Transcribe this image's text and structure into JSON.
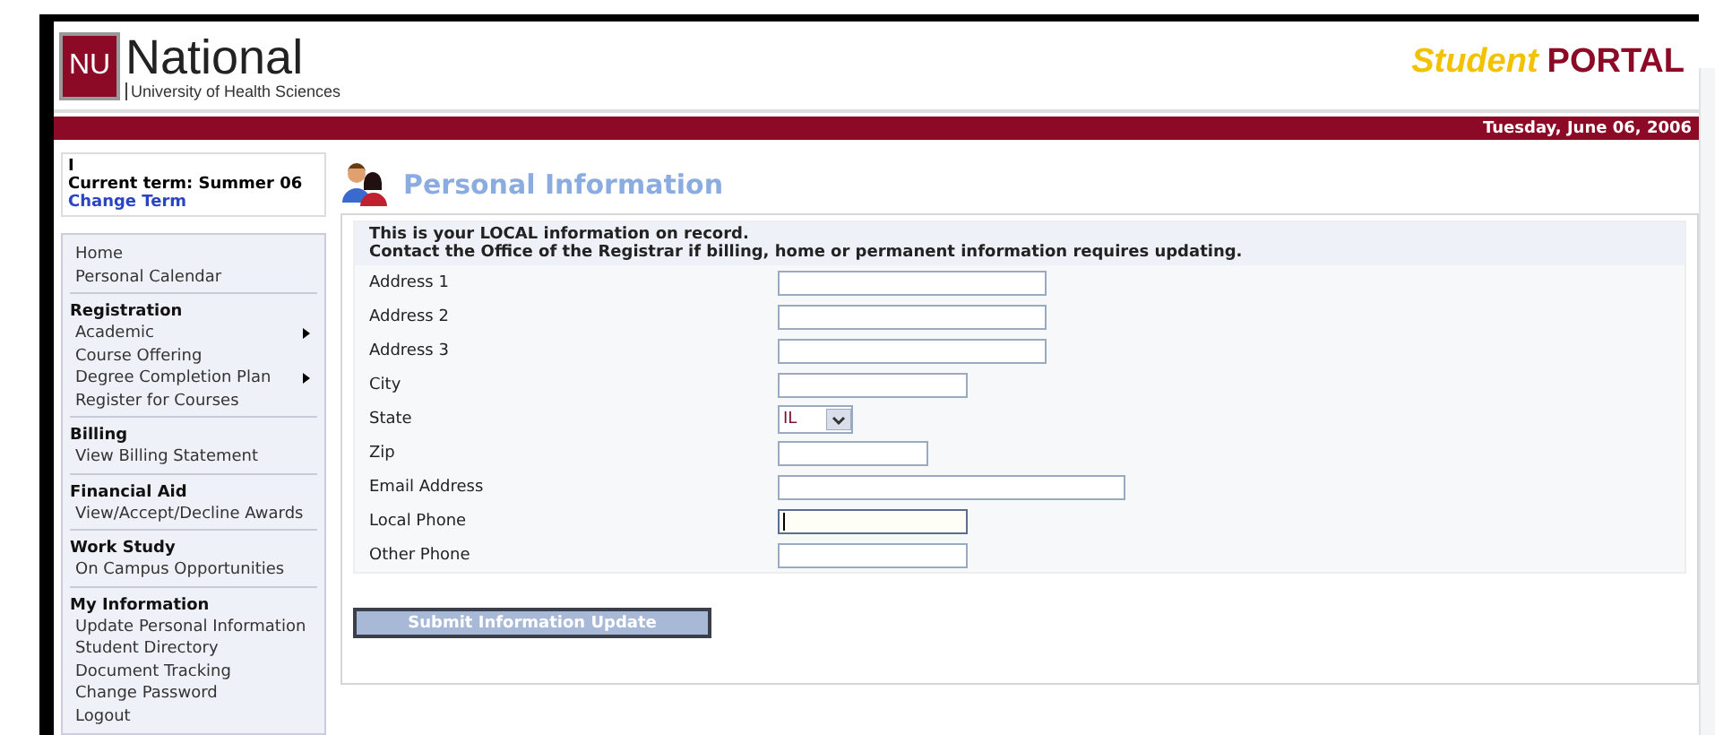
{
  "header": {
    "logo_mark": "NU",
    "logo_name": "National",
    "logo_subtitle": "University of Health Sciences",
    "portal_word1": "Student",
    "portal_word2": "PORTAL"
  },
  "date_bar": {
    "date": "Tuesday, June 06, 2006"
  },
  "term_box": {
    "user": "I",
    "current_term": "Current term: Summer 06",
    "change_link": "Change Term"
  },
  "sidebar": {
    "groups": [
      {
        "items": [
          {
            "label": "Home",
            "has_submenu": false
          },
          {
            "label": "Personal Calendar",
            "has_submenu": false
          }
        ]
      },
      {
        "heading": "Registration",
        "items": [
          {
            "label": "Academic",
            "has_submenu": true
          },
          {
            "label": "Course Offering",
            "has_submenu": false
          },
          {
            "label": "Degree Completion Plan",
            "has_submenu": true
          },
          {
            "label": "Register for Courses",
            "has_submenu": false
          }
        ]
      },
      {
        "heading": "Billing",
        "items": [
          {
            "label": "View Billing Statement",
            "has_submenu": false
          }
        ]
      },
      {
        "heading": "Financial Aid",
        "items": [
          {
            "label": "View/Accept/Decline Awards",
            "has_submenu": false
          }
        ]
      },
      {
        "heading": "Work Study",
        "items": [
          {
            "label": "On Campus Opportunities",
            "has_submenu": false
          }
        ]
      },
      {
        "heading": "My Information",
        "items": [
          {
            "label": "Update Personal Information",
            "has_submenu": false
          },
          {
            "label": "Student Directory",
            "has_submenu": false
          },
          {
            "label": "Document Tracking",
            "has_submenu": false
          },
          {
            "label": "Change Password",
            "has_submenu": false
          },
          {
            "label": "Logout",
            "has_submenu": false
          }
        ]
      }
    ]
  },
  "page_title": "Personal Information",
  "notice": [
    "This is your LOCAL information on record.",
    "Contact the Office of the Registrar if billing, home or permanent information requires updating."
  ],
  "fields": [
    {
      "label": "Address 1",
      "kind": "wide",
      "focused": false
    },
    {
      "label": "Address 2",
      "kind": "wide",
      "focused": false
    },
    {
      "label": "Address 3",
      "kind": "wide",
      "focused": false
    },
    {
      "label": "City",
      "kind": "medium",
      "focused": false
    },
    {
      "label": "State",
      "kind": "select",
      "value": "IL"
    },
    {
      "label": "Zip",
      "kind": "short",
      "focused": false
    },
    {
      "label": "Email Address",
      "kind": "long",
      "focused": false
    },
    {
      "label": "Local Phone",
      "kind": "medium",
      "focused": true
    },
    {
      "label": "Other Phone",
      "kind": "medium",
      "focused": false
    }
  ],
  "submit_button": "Submit Information Update"
}
